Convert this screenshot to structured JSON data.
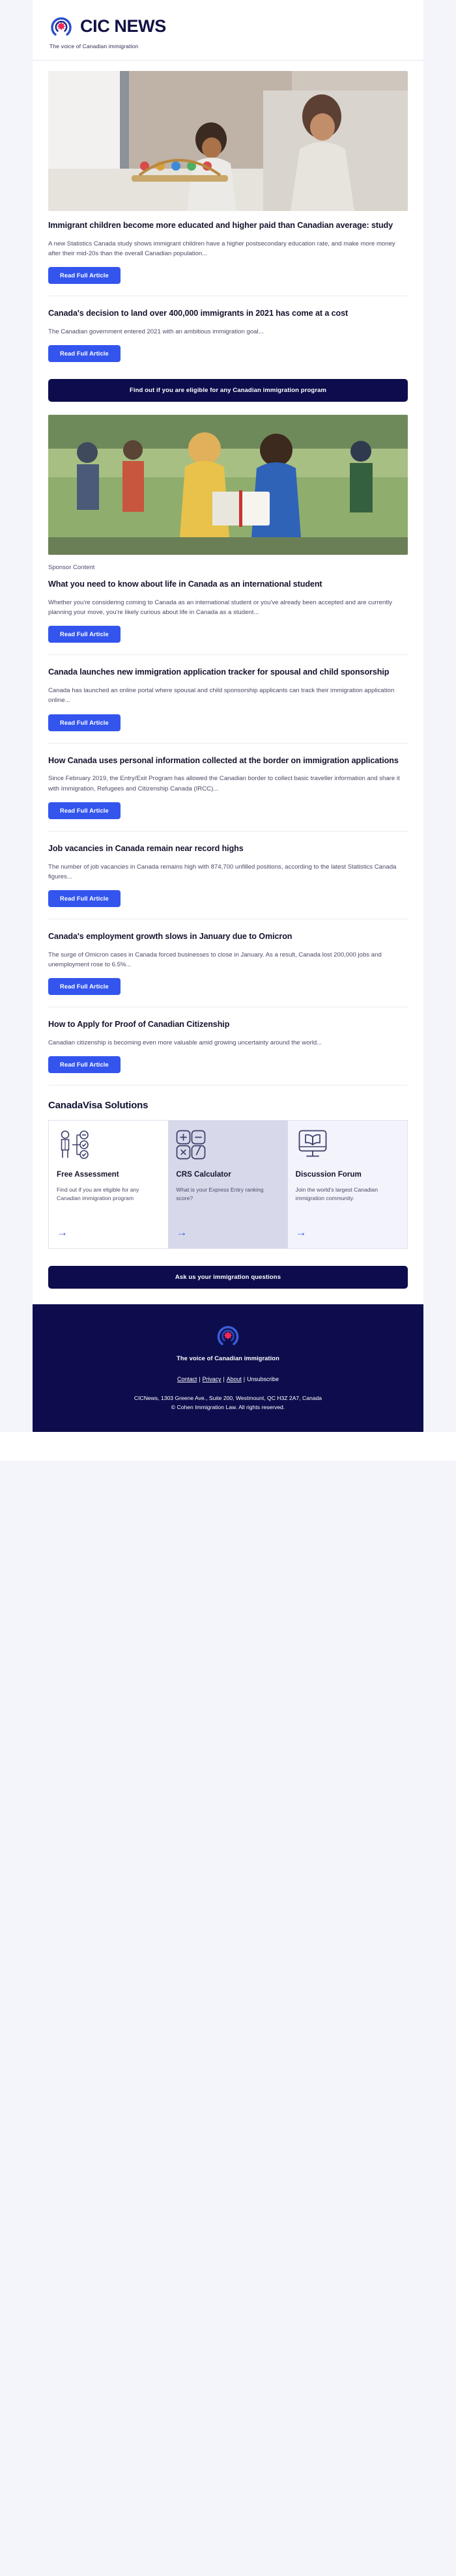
{
  "brand": {
    "name": "CIC NEWS",
    "tagline": "The voice of Canadian immigration",
    "logo_icon": "cic-target-maple-leaf-logo",
    "accent_blue": "#3355ee",
    "deep_navy": "#0d0d4d"
  },
  "articles": [
    {
      "image": "mother-and-baby-with-abacus-on-sofa",
      "kicker": "",
      "headline": "Immigrant children become more educated and higher paid than Canadian average: study",
      "excerpt": "A new Statistics Canada study shows immigrant children have a higher postsecondary education rate, and make more money after their mid-20s than the overall Canadian population...",
      "button": "Read Full Article"
    },
    {
      "image": "",
      "kicker": "",
      "headline": "Canada's decision to land over 400,000 immigrants in 2021 has come at a cost",
      "excerpt": "The Canadian government entered 2021 with an ambitious immigration goal...",
      "button": "Read Full Article"
    }
  ],
  "cta_eligibility": "Find out if you are eligible for any Canadian immigration program",
  "sponsor_article": {
    "image": "two-students-with-book-outdoors",
    "kicker": "Sponsor Content",
    "headline": "What you need to know about life in Canada as an international student",
    "excerpt": "Whether you're considering coming to Canada as an international student or you've already been accepted and are currently planning your move, you're likely curious about life in Canada as a student...",
    "button": "Read Full Article"
  },
  "articles_rest": [
    {
      "headline": "Canada launches new immigration application tracker for spousal and child sponsorship",
      "excerpt": "Canada has launched an online portal where spousal and child sponsorship applicants can track their immigration application online...",
      "button": "Read Full Article"
    },
    {
      "headline": "How Canada uses personal information collected at the border on immigration applications",
      "excerpt": "Since February 2019, the Entry/Exit Program has allowed the Canadian border to collect basic traveller information and share it with Immigration, Refugees and Citizenship Canada (IRCC)...",
      "button": "Read Full Article"
    },
    {
      "headline": "Job vacancies in Canada remain near record highs",
      "excerpt": "The number of job vacancies in Canada remains high with 874,700 unfilled positions, according to the latest Statistics Canada figures...",
      "button": "Read Full Article"
    },
    {
      "headline": "Canada's employment growth slows in January due to Omicron",
      "excerpt": "The surge of Omicron cases in Canada forced businesses to close in January. As a result, Canada lost 200,000 jobs and unemployment rose to 6.5%...",
      "button": "Read Full Article"
    },
    {
      "headline": "How to Apply for Proof of Canadian Citizenship",
      "excerpt": "Canadian citizenship is becoming even more valuable amid growing uncertainty around the world...",
      "button": "Read Full Article"
    }
  ],
  "solutions": {
    "title": "CanadaVisa Solutions",
    "cards": [
      {
        "icon": "person-checklist-icon",
        "title": "Free Assessment",
        "desc": "Find out if you are eligible for any Canadian immigration program",
        "arrow": "→"
      },
      {
        "icon": "calculator-keys-icon",
        "title": "CRS Calculator",
        "desc": "What is your Express Entry ranking score?",
        "arrow": "→"
      },
      {
        "icon": "monitor-open-book-icon",
        "title": "Discussion Forum",
        "desc": "Join the world's largest Canadian immigration community.",
        "arrow": "→"
      }
    ]
  },
  "cta_questions": "Ask us your immigration questions",
  "footer": {
    "logo_icon": "cic-target-maple-leaf-logo",
    "tagline": "The voice of Canadian immigration",
    "links": [
      {
        "label": "Contact",
        "underline": true
      },
      {
        "label": "Privacy",
        "underline": true
      },
      {
        "label": "About",
        "underline": true
      },
      {
        "label": "Unsubscribe",
        "underline": false
      }
    ],
    "separator": "|",
    "address": "CICNews, 1303 Greene Ave., Suite 200, Westmount, QC H3Z 2A7, Canada",
    "copyright": "© Cohen Immigration Law. All rights reserved."
  }
}
